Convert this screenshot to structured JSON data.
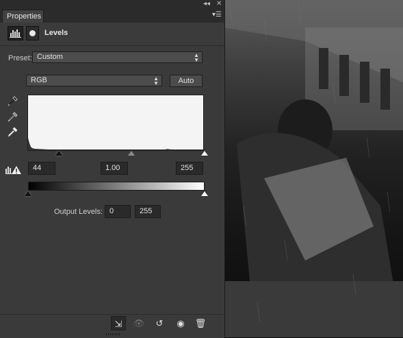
{
  "panel": {
    "tab_label": "Properties",
    "collapse_icon": "double-chevron-icon",
    "close_icon": "close-icon",
    "menu_icon": "panel-menu-icon"
  },
  "header": {
    "title": "Levels",
    "adjustment_icon": "levels-histogram-icon",
    "mask_icon": "layer-mask-icon"
  },
  "preset": {
    "label": "Preset:",
    "value": "Custom"
  },
  "channel": {
    "value": "RGB",
    "auto_label": "Auto"
  },
  "pickers": [
    "black-point-eyedropper-icon",
    "gray-point-eyedropper-icon",
    "white-point-eyedropper-icon"
  ],
  "input_levels": {
    "black": "44",
    "gamma": "1.00",
    "white": "255",
    "black_fraction": 0.173,
    "gamma_fraction": 0.587,
    "white_fraction": 1.0
  },
  "output_levels": {
    "label": "Output Levels:",
    "black": "0",
    "white": "255",
    "black_fraction": 0.0,
    "white_fraction": 1.0
  },
  "footer": {
    "icons": [
      "clip-to-layer-icon",
      "view-previous-state-icon",
      "reset-icon",
      "visibility-eye-icon",
      "trash-icon"
    ]
  },
  "colors": {
    "panel_bg": "#3a3a3a",
    "field_bg": "#2a2a2a",
    "histogram_bg": "#f4f4f4"
  }
}
